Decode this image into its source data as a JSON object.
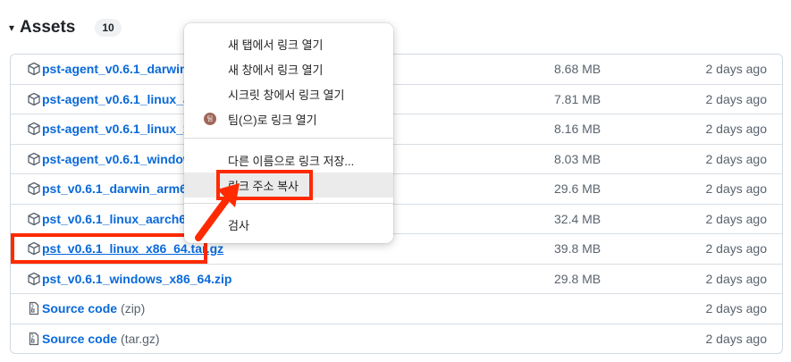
{
  "header": {
    "caret": "▾",
    "title": "Assets",
    "count": "10"
  },
  "assets": [
    {
      "name": "pst-agent_v0.6.1_darwin_a",
      "suffix": "",
      "size": "8.68 MB",
      "date": "2 days ago",
      "icon": "package-icon"
    },
    {
      "name": "pst-agent_v0.6.1_linux_aar",
      "suffix": "",
      "size": "7.81 MB",
      "date": "2 days ago",
      "icon": "package-icon"
    },
    {
      "name": "pst-agent_v0.6.1_linux_x86",
      "suffix": "",
      "size": "8.16 MB",
      "date": "2 days ago",
      "icon": "package-icon"
    },
    {
      "name": "pst-agent_v0.6.1_windows",
      "suffix": "",
      "size": "8.03 MB",
      "date": "2 days ago",
      "icon": "package-icon"
    },
    {
      "name": "pst_v0.6.1_darwin_arm64.t",
      "suffix": "",
      "size": "29.6 MB",
      "date": "2 days ago",
      "icon": "package-icon"
    },
    {
      "name": "pst_v0.6.1_linux_aarch64.t",
      "suffix": "",
      "size": "32.4 MB",
      "date": "2 days ago",
      "icon": "package-icon"
    },
    {
      "name": "pst_v0.6.1_linux_x86_64.tar.gz",
      "suffix": "",
      "size": "39.8 MB",
      "date": "2 days ago",
      "icon": "package-icon"
    },
    {
      "name": "pst_v0.6.1_windows_x86_64.zip",
      "suffix": "",
      "size": "29.8 MB",
      "date": "2 days ago",
      "icon": "package-icon"
    },
    {
      "name": "Source code",
      "suffix": "(zip)",
      "size": "",
      "date": "2 days ago",
      "icon": "file-zip-icon"
    },
    {
      "name": "Source code",
      "suffix": "(tar.gz)",
      "size": "",
      "date": "2 days ago",
      "icon": "file-zip-icon"
    }
  ],
  "context_menu": {
    "items": [
      {
        "label": "새 탭에서 링크 열기"
      },
      {
        "label": "새 창에서 링크 열기"
      },
      {
        "label": "시크릿 창에서 링크 열기"
      },
      {
        "label": "팀(으)로 링크 열기",
        "badge": "팀"
      },
      {
        "label": "다른 이름으로 링크 저장..."
      },
      {
        "label": "링크 주소 복사"
      },
      {
        "label": "검사"
      }
    ]
  },
  "colors": {
    "link": "#0969da",
    "annotation": "#ff2a00",
    "hover": "#ebebeb"
  }
}
